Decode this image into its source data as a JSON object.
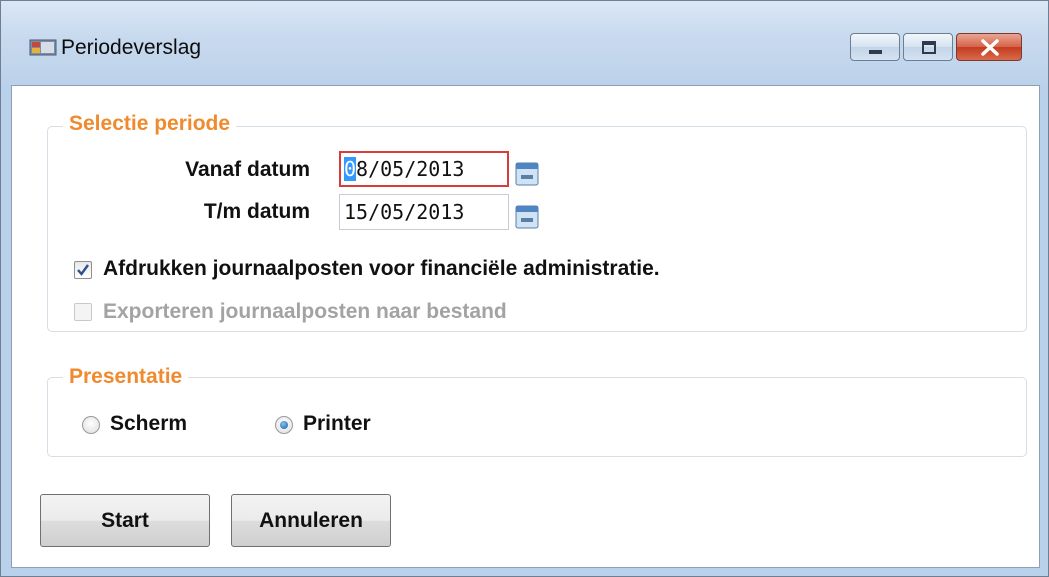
{
  "window": {
    "title": "Periodeverslag"
  },
  "selection": {
    "legend": "Selectie periode",
    "from_label": "Vanaf datum",
    "from_value_first": "0",
    "from_value_rest": "8/05/2013",
    "to_label": "T/m datum",
    "to_value": "15/05/2013",
    "print_journal_label": "Afdrukken journaalposten voor financiële administratie.",
    "print_journal_checked": true,
    "export_journal_label": "Exporteren journaalposten naar bestand",
    "export_journal_checked": false,
    "export_journal_enabled": false
  },
  "presentation": {
    "legend": "Presentatie",
    "options": [
      {
        "label": "Scherm",
        "selected": false
      },
      {
        "label": "Printer",
        "selected": true
      }
    ]
  },
  "buttons": {
    "start": "Start",
    "cancel": "Annuleren"
  },
  "colors": {
    "legend": "#f08a2e",
    "focus_border": "#d93a3a",
    "selection_highlight": "#3399ff"
  }
}
